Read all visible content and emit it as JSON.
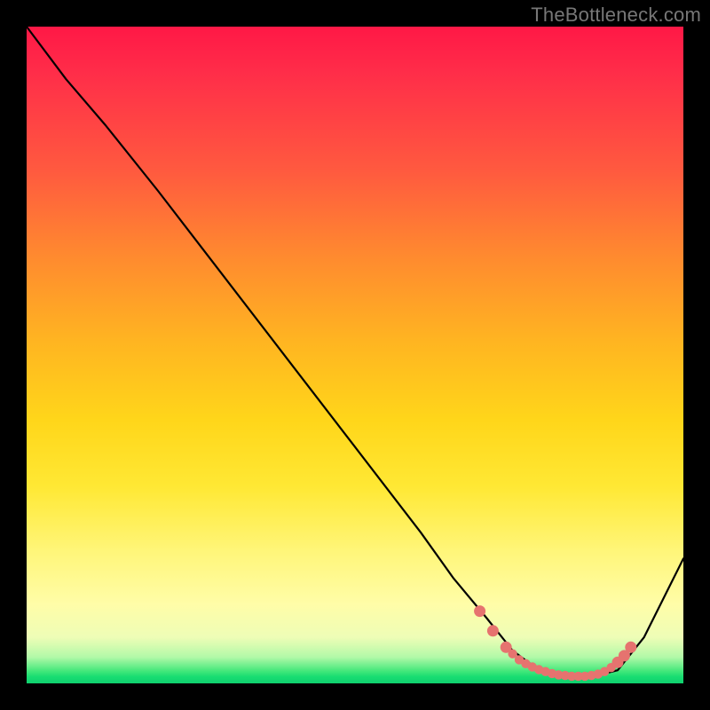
{
  "watermark": "TheBottleneck.com",
  "chart_data": {
    "type": "line",
    "title": "",
    "xlabel": "",
    "ylabel": "",
    "xlim": [
      0,
      100
    ],
    "ylim": [
      0,
      100
    ],
    "grid": false,
    "legend": false,
    "series": [
      {
        "name": "bottleneck-curve",
        "color": "#000000",
        "x": [
          0,
          6,
          12,
          20,
          30,
          40,
          50,
          60,
          65,
          70,
          74,
          78,
          82,
          86,
          90,
          94,
          98,
          100
        ],
        "y": [
          100,
          92,
          85,
          75,
          62,
          49,
          36,
          23,
          16,
          10,
          5,
          2,
          1,
          1,
          2,
          7,
          15,
          19
        ]
      }
    ],
    "markers": {
      "name": "dotted-trough-highlight",
      "color": "#e6736f",
      "points": [
        {
          "x": 69,
          "y": 11
        },
        {
          "x": 71,
          "y": 8
        },
        {
          "x": 73,
          "y": 5.5
        },
        {
          "x": 74,
          "y": 4.5
        },
        {
          "x": 75,
          "y": 3.6
        },
        {
          "x": 76,
          "y": 3.0
        },
        {
          "x": 77,
          "y": 2.5
        },
        {
          "x": 78,
          "y": 2.1
        },
        {
          "x": 79,
          "y": 1.8
        },
        {
          "x": 80,
          "y": 1.5
        },
        {
          "x": 81,
          "y": 1.3
        },
        {
          "x": 82,
          "y": 1.2
        },
        {
          "x": 83,
          "y": 1.1
        },
        {
          "x": 84,
          "y": 1.1
        },
        {
          "x": 85,
          "y": 1.1
        },
        {
          "x": 86,
          "y": 1.2
        },
        {
          "x": 87,
          "y": 1.4
        },
        {
          "x": 88,
          "y": 1.8
        },
        {
          "x": 89,
          "y": 2.4
        },
        {
          "x": 90,
          "y": 3.2
        },
        {
          "x": 91,
          "y": 4.2
        },
        {
          "x": 92,
          "y": 5.5
        }
      ]
    },
    "background": {
      "type": "vertical-gradient",
      "stops": [
        {
          "pos": 0.0,
          "color": "#ff1846"
        },
        {
          "pos": 0.5,
          "color": "#ffd61a"
        },
        {
          "pos": 0.9,
          "color": "#fffda8"
        },
        {
          "pos": 0.98,
          "color": "#3fe779"
        },
        {
          "pos": 1.0,
          "color": "#0fd06e"
        }
      ]
    }
  }
}
